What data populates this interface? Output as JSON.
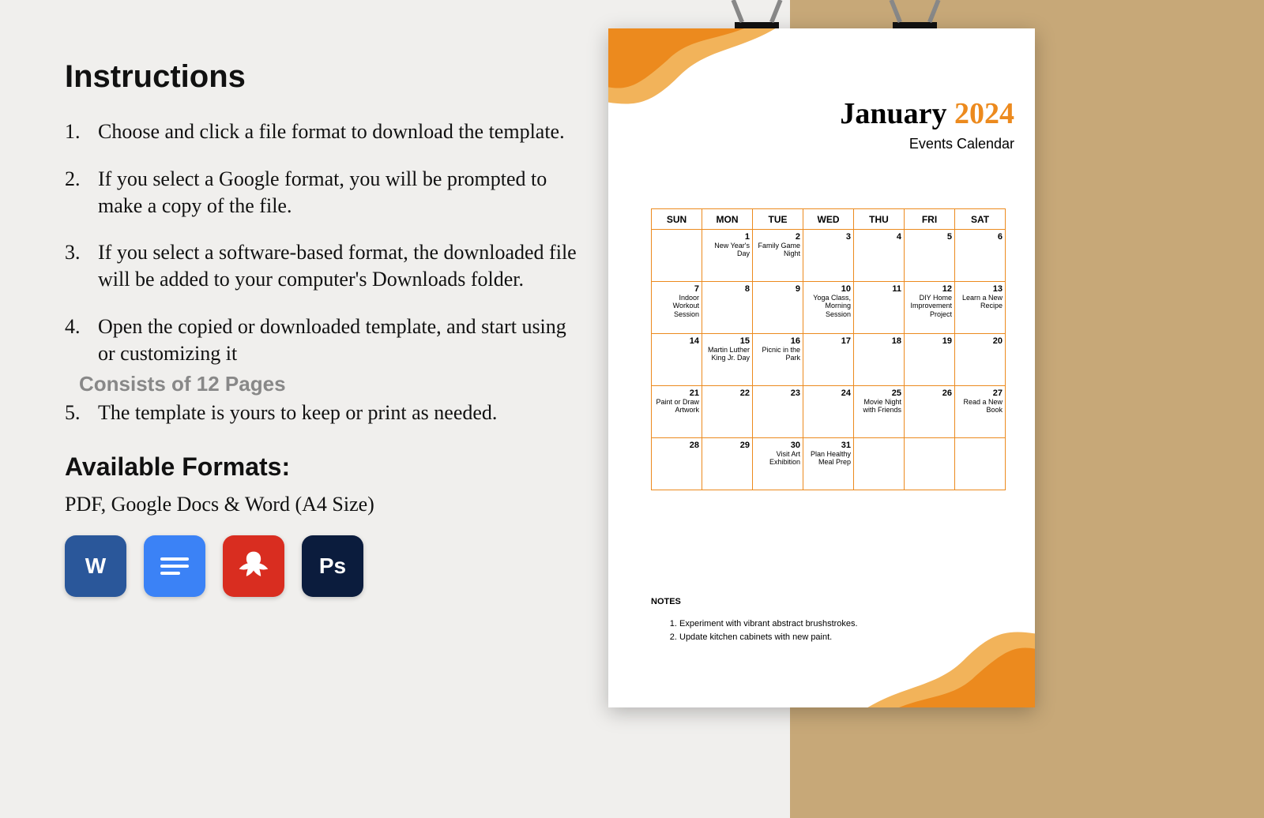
{
  "instructions": {
    "heading": "Instructions",
    "steps": [
      "Choose and click a file format to download the template.",
      "If you select a Google format, you will be prompted to make a copy of the file.",
      "If you select a software-based format, the downloaded file will be added to your computer's Downloads folder.",
      "Open the copied or downloaded template, and start using or customizing it",
      "The template is yours to keep or print as needed."
    ],
    "pages_note": "Consists of 12 Pages",
    "formats_heading": "Available Formats:",
    "formats_sub": "PDF, Google Docs & Word (A4 Size)",
    "format_icons": [
      {
        "name": "word-icon",
        "label": "W"
      },
      {
        "name": "google-docs-icon",
        "label": "docs"
      },
      {
        "name": "pdf-icon",
        "label": "pdf"
      },
      {
        "name": "photoshop-icon",
        "label": "Ps"
      }
    ]
  },
  "calendar": {
    "month": "January",
    "year": "2024",
    "subtitle": "Events Calendar",
    "day_headers": [
      "SUN",
      "MON",
      "TUE",
      "WED",
      "THU",
      "FRI",
      "SAT"
    ],
    "weeks": [
      [
        {
          "num": "",
          "event": ""
        },
        {
          "num": "1",
          "event": "New Year's Day"
        },
        {
          "num": "2",
          "event": "Family Game Night"
        },
        {
          "num": "3",
          "event": ""
        },
        {
          "num": "4",
          "event": ""
        },
        {
          "num": "5",
          "event": ""
        },
        {
          "num": "6",
          "event": ""
        }
      ],
      [
        {
          "num": "7",
          "event": "Indoor Workout Session"
        },
        {
          "num": "8",
          "event": ""
        },
        {
          "num": "9",
          "event": ""
        },
        {
          "num": "10",
          "event": "Yoga Class, Morning Session"
        },
        {
          "num": "11",
          "event": ""
        },
        {
          "num": "12",
          "event": "DIY Home Improvement Project"
        },
        {
          "num": "13",
          "event": "Learn a New Recipe"
        }
      ],
      [
        {
          "num": "14",
          "event": ""
        },
        {
          "num": "15",
          "event": "Martin Luther King Jr. Day"
        },
        {
          "num": "16",
          "event": "Picnic in the Park"
        },
        {
          "num": "17",
          "event": ""
        },
        {
          "num": "18",
          "event": ""
        },
        {
          "num": "19",
          "event": ""
        },
        {
          "num": "20",
          "event": ""
        }
      ],
      [
        {
          "num": "21",
          "event": "Paint or Draw Artwork"
        },
        {
          "num": "22",
          "event": ""
        },
        {
          "num": "23",
          "event": ""
        },
        {
          "num": "24",
          "event": ""
        },
        {
          "num": "25",
          "event": "Movie Night with Friends"
        },
        {
          "num": "26",
          "event": ""
        },
        {
          "num": "27",
          "event": "Read a New Book"
        }
      ],
      [
        {
          "num": "28",
          "event": ""
        },
        {
          "num": "29",
          "event": ""
        },
        {
          "num": "30",
          "event": "Visit Art Exhibition"
        },
        {
          "num": "31",
          "event": "Plan Healthy Meal Prep"
        },
        {
          "num": "",
          "event": ""
        },
        {
          "num": "",
          "event": ""
        },
        {
          "num": "",
          "event": ""
        }
      ]
    ],
    "notes_heading": "NOTES",
    "notes_items": [
      "Experiment with vibrant abstract brushstrokes.",
      "Update kitchen cabinets with new paint."
    ]
  }
}
